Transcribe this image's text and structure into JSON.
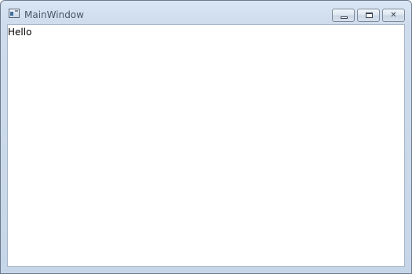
{
  "window": {
    "title": "MainWindow",
    "icon": "app-window-icon"
  },
  "caption_buttons": {
    "minimize_icon": "minimize-icon",
    "maximize_icon": "maximize-icon",
    "close_icon": "close-icon"
  },
  "content": {
    "text": "Hello"
  },
  "colors": {
    "frame": "#cfdcec",
    "client_background": "#ffffff",
    "title_text": "#4b5566"
  }
}
